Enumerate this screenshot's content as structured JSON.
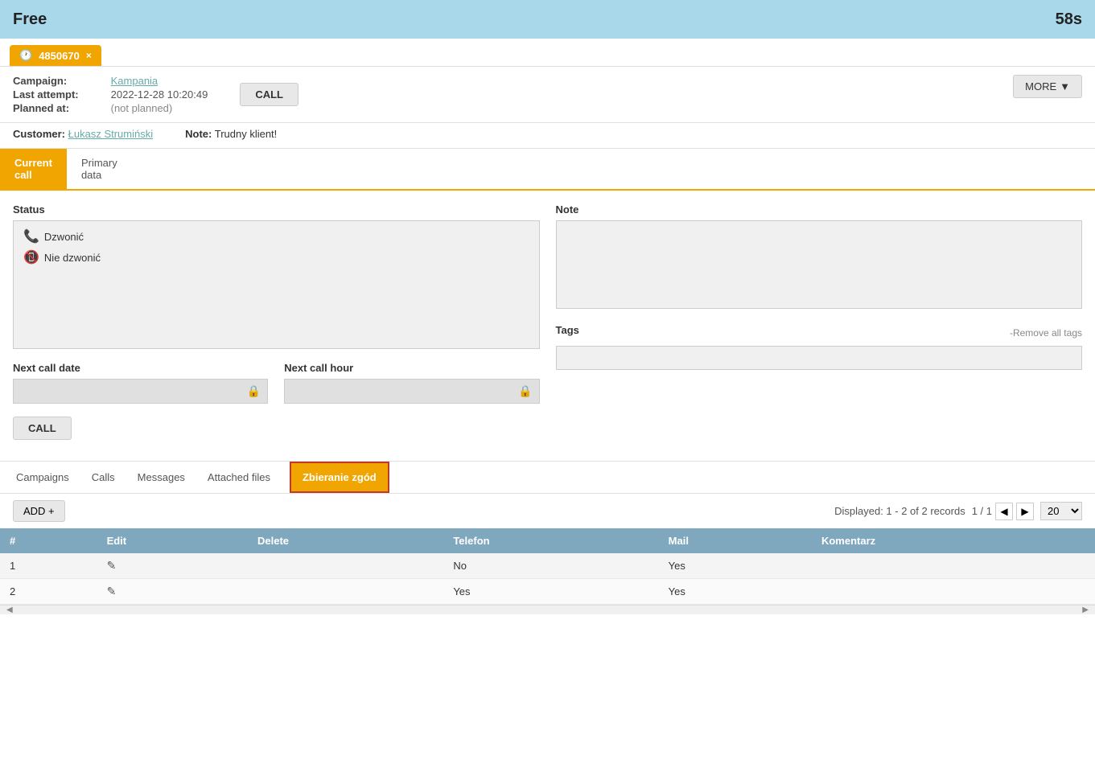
{
  "topbar": {
    "title": "Free",
    "timer": "58s"
  },
  "tab": {
    "phone": "4850670",
    "close_label": "×"
  },
  "info": {
    "campaign_label": "Campaign:",
    "campaign_value": "Kampania",
    "last_attempt_label": "Last attempt:",
    "last_attempt_value": "2022-12-28 10:20:49",
    "planned_label": "Planned at:",
    "planned_value": "(not planned)",
    "call_btn": "CALL",
    "more_btn": "MORE"
  },
  "customer": {
    "label": "Customer:",
    "name": "Łukasz Strumiński",
    "note_label": "Note:",
    "note_value": "Trudny klient!"
  },
  "section_tabs": [
    {
      "id": "current-call",
      "label": "Current call",
      "active": true
    },
    {
      "id": "primary-data",
      "label": "Primary data",
      "active": false
    }
  ],
  "status": {
    "label": "Status",
    "items": [
      {
        "id": "dzwonic",
        "icon": "green",
        "text": "Dzwonić"
      },
      {
        "id": "nie-dzwonic",
        "icon": "red",
        "text": "Nie dzwonić"
      }
    ]
  },
  "next_call_date": {
    "label": "Next call date",
    "placeholder": "",
    "lock_icon": "🔒"
  },
  "next_call_hour": {
    "label": "Next call hour",
    "placeholder": "",
    "lock_icon": "🔒"
  },
  "call_bottom_btn": "CALL",
  "note": {
    "label": "Note",
    "placeholder": ""
  },
  "tags": {
    "label": "Tags",
    "remove_label": "-Remove all tags"
  },
  "bottom_tabs": [
    {
      "id": "campaigns",
      "label": "Campaigns",
      "active": false
    },
    {
      "id": "calls",
      "label": "Calls",
      "active": false
    },
    {
      "id": "messages",
      "label": "Messages",
      "active": false
    },
    {
      "id": "attached-files",
      "label": "Attached files",
      "active": false
    },
    {
      "id": "zbieranie-zgod",
      "label": "Zbieranie zgód",
      "active": true
    }
  ],
  "table": {
    "add_btn": "ADD +",
    "displayed_text": "Displayed: 1 - 2 of 2 records",
    "page_info": "1 / 1",
    "per_page": "20",
    "columns": [
      "#",
      "Edit",
      "Delete",
      "Telefon",
      "Mail",
      "Komentarz"
    ],
    "rows": [
      {
        "num": "1",
        "telefon": "No",
        "mail": "Yes",
        "komentarz": ""
      },
      {
        "num": "2",
        "telefon": "Yes",
        "mail": "Yes",
        "komentarz": ""
      }
    ]
  }
}
